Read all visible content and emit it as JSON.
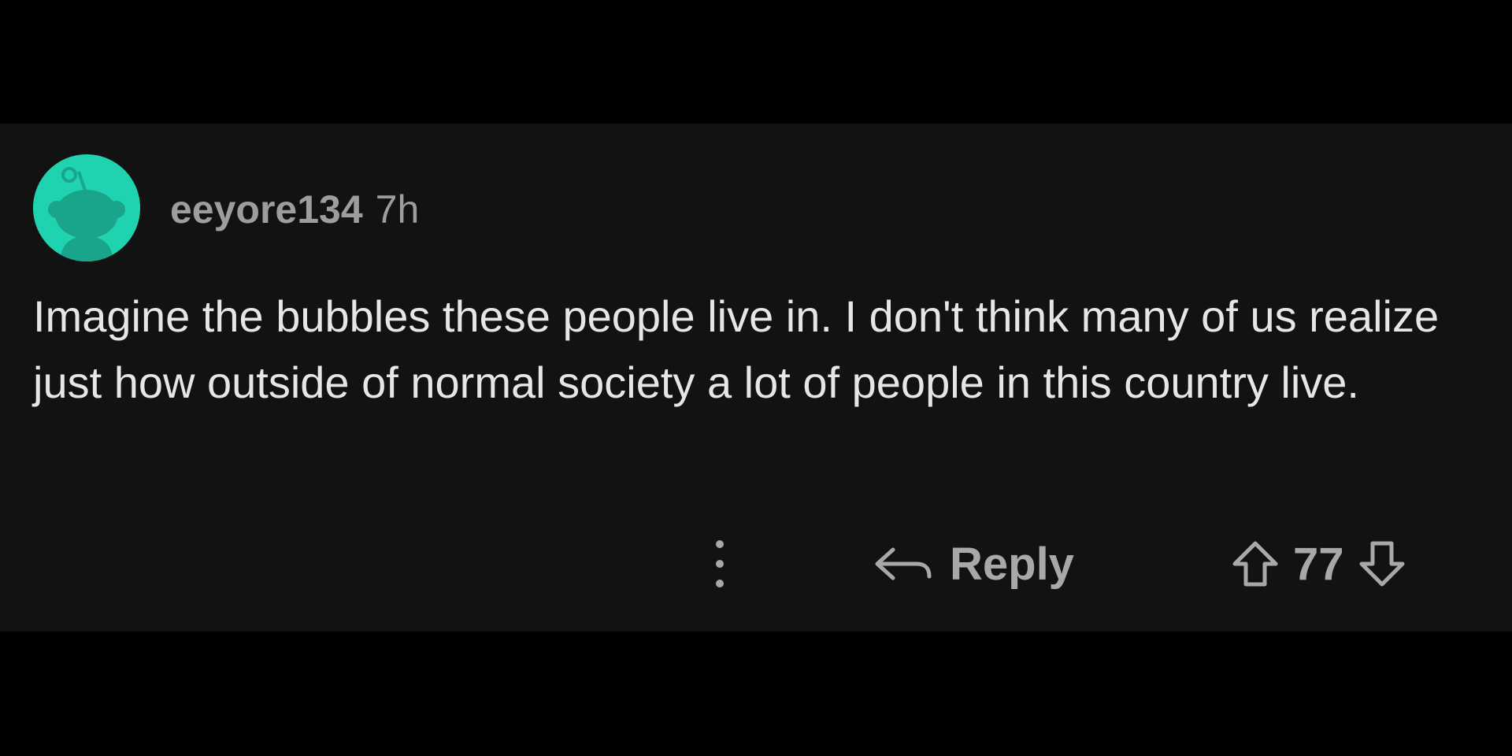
{
  "comment": {
    "username": "eeyore134",
    "timestamp": "7h",
    "body": "Imagine the bubbles these people live in. I don't think many of us realize just how outside of normal society a lot of people in this country live.",
    "score": "77"
  },
  "actions": {
    "reply_label": "Reply",
    "more_icon": "more-vertical-icon",
    "reply_icon": "reply-arrow-icon",
    "upvote_icon": "upvote-arrow-icon",
    "downvote_icon": "downvote-arrow-icon"
  },
  "colors": {
    "background": "#000000",
    "card": "#121212",
    "avatar": "#20d3b0",
    "text": "#e6e6e6",
    "muted": "#a8a8a8"
  }
}
